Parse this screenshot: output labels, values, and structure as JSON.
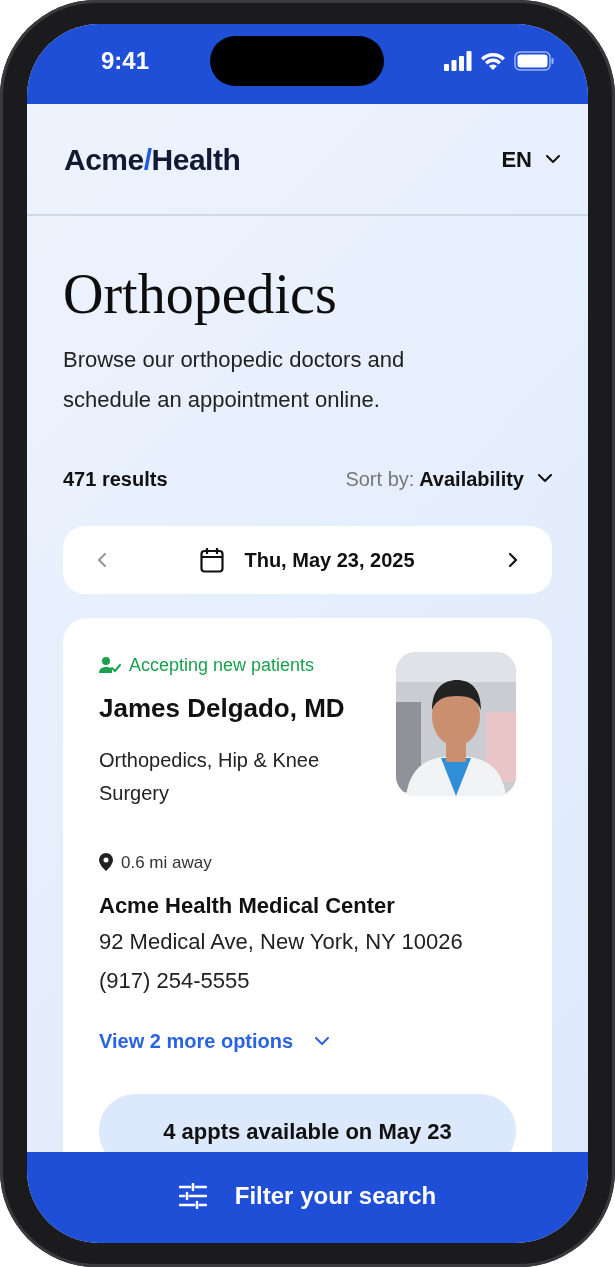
{
  "status_bar": {
    "time": "9:41"
  },
  "header": {
    "logo": [
      {
        "text": "Acme",
        "accent": false
      },
      {
        "text": "/",
        "accent": true
      },
      {
        "text": "Health",
        "accent": false
      }
    ],
    "language": "EN"
  },
  "page": {
    "title": "Orthopedics",
    "description": "Browse our orthopedic doctors and schedule an appointment online."
  },
  "results": {
    "count": "471 results",
    "sort_label": "Sort by:",
    "sort_value": "Availability"
  },
  "date_nav": {
    "label": "Thu, May 23, 2025",
    "prev": {
      "disabled": true
    },
    "next": {
      "disabled": false
    }
  },
  "doctor": {
    "status": "Accepting new patients",
    "name": "James Delgado, MD",
    "specialty": "Orthopedics, Hip & Knee Surgery",
    "distance": "0.6 mi away",
    "facility": "Acme Health Medical Center",
    "address": "92 Medical Ave, New York, NY 10026",
    "phone": "(917) 254-5555",
    "more_options": "View 2 more options",
    "appointments": "4 appts available on May 23"
  },
  "filter_button": {
    "label": "Filter your search"
  }
}
